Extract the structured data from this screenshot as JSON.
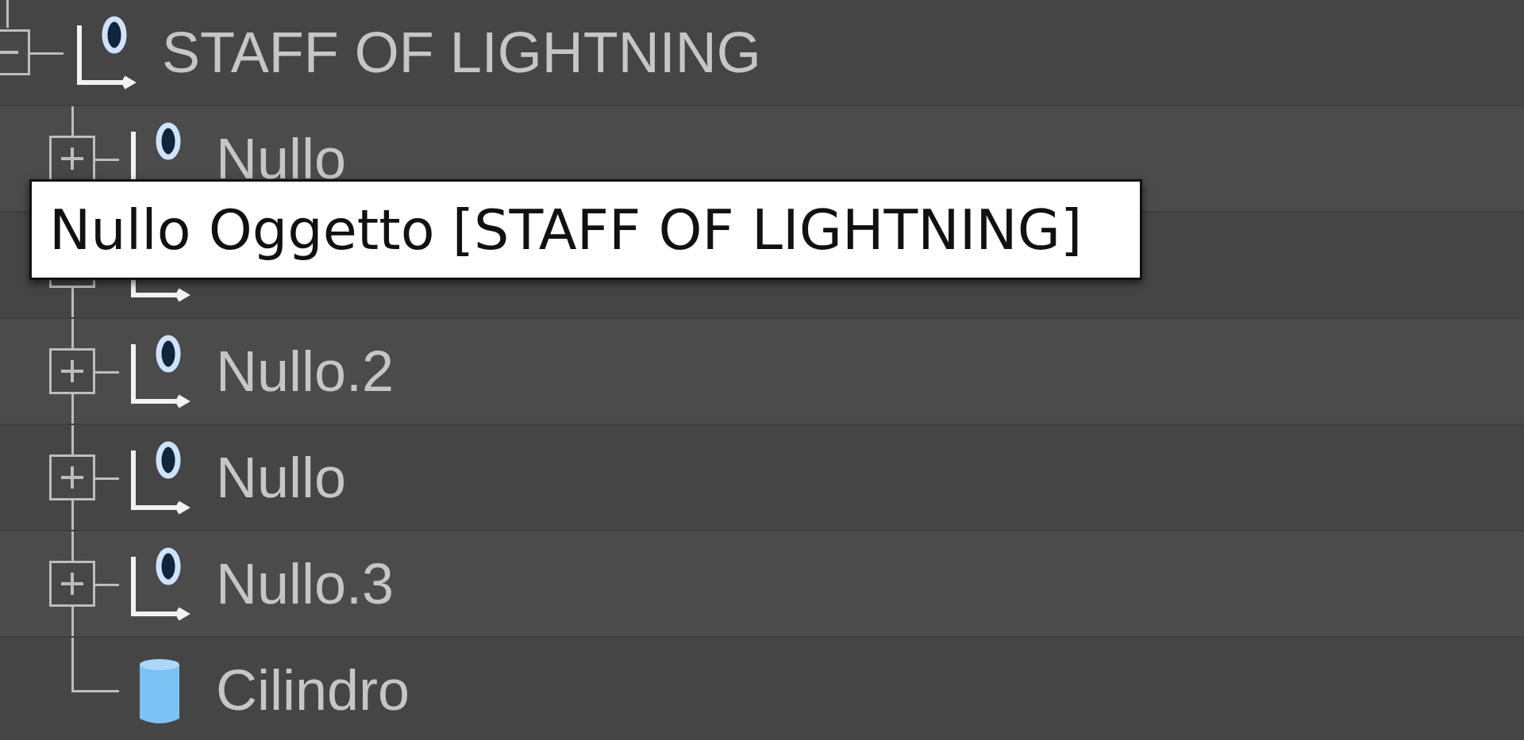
{
  "objects": [
    {
      "name": "STAFF OF LIGHTNING",
      "kind": "null",
      "expanded": true,
      "children": [
        {
          "name": "Nullo",
          "kind": "null",
          "expanded": false
        },
        {
          "kind": "null",
          "expander": true
        },
        {
          "name": "Nullo.2",
          "kind": "null",
          "expanded": false
        },
        {
          "name": "Nullo",
          "kind": "null",
          "expanded": false
        },
        {
          "name": "Nullo.3",
          "kind": "null",
          "expanded": false
        },
        {
          "name": "Cilindro",
          "kind": "cylinder"
        }
      ]
    }
  ],
  "tooltip": {
    "text": "Nullo Oggetto [STAFF OF LIGHTNING]"
  }
}
